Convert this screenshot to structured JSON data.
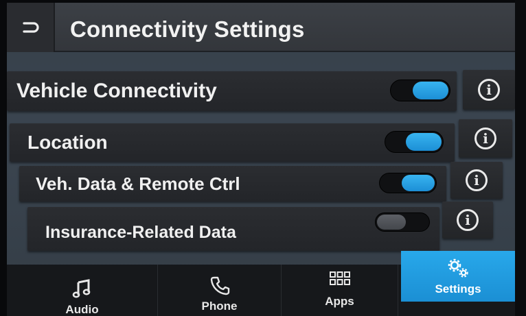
{
  "header": {
    "title": "Connectivity Settings",
    "back_icon": "back-arrow-icon"
  },
  "settings": [
    {
      "label": "Vehicle Connectivity",
      "enabled": true
    },
    {
      "label": "Location",
      "enabled": true
    },
    {
      "label": "Veh. Data & Remote Ctrl",
      "enabled": true
    },
    {
      "label": "Insurance-Related Data",
      "enabled": false
    }
  ],
  "info_glyph": "i",
  "nav": [
    {
      "label": "Audio",
      "icon": "music-note-icon",
      "active": false
    },
    {
      "label": "Phone",
      "icon": "phone-icon",
      "active": false
    },
    {
      "label": "Apps",
      "icon": "apps-grid-icon",
      "active": false
    },
    {
      "label": "Settings",
      "icon": "gears-icon",
      "active": true
    }
  ],
  "colors": {
    "accent": "#1e95dc",
    "toggle_on": "#2aa5e8",
    "toggle_off": "#4d5055",
    "row_bg": "#26282c",
    "screen_bg": "#38424c"
  }
}
